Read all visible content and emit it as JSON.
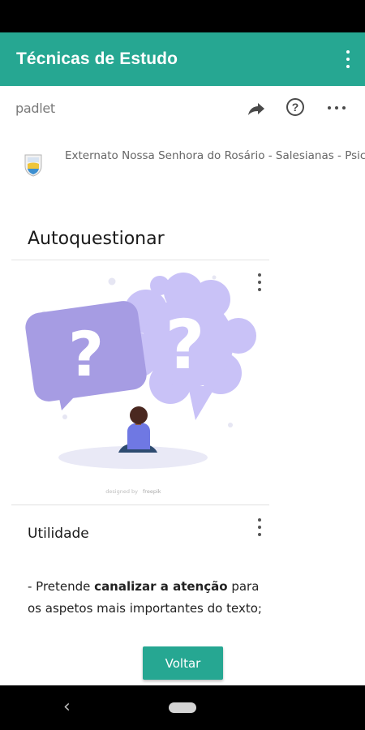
{
  "app": {
    "title": "Técnicas de Estudo",
    "accent_color": "#26a792"
  },
  "padlet": {
    "brand": "padlet",
    "icons": [
      "share-icon",
      "help-icon",
      "more-icon"
    ]
  },
  "school": {
    "name": "Externato Nossa Senhora do Rosário - Salesianas - Psic"
  },
  "section": {
    "title": "Autoquestionar"
  },
  "image": {
    "credit_prefix": "designed by",
    "credit_brand": "freepik",
    "question_mark": "?"
  },
  "post": {
    "title": "Utilidade",
    "body_prefix": "- Pretende ",
    "body_bold": "canalizar a atenção",
    "body_suffix": " para os aspetos mais importantes do texto;"
  },
  "actions": {
    "back_label": "Voltar"
  },
  "nav": {
    "back_glyph": "‹"
  }
}
